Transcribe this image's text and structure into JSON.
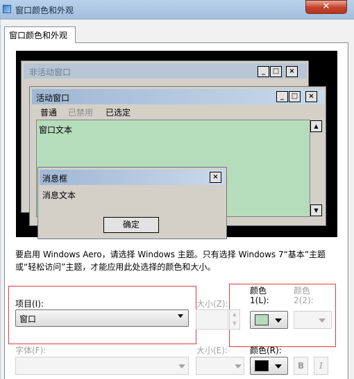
{
  "window": {
    "title": "窗口颜色和外观",
    "close_glyph": "✕"
  },
  "tab": {
    "label": "窗口颜色和外观"
  },
  "preview": {
    "inactive_window_title": "非活动窗口",
    "active_window_title": "活动窗口",
    "menu": {
      "normal": "普通",
      "disabled": "已禁用",
      "selected": "已选定"
    },
    "window_text": "窗口文本",
    "message_box": {
      "title": "消息框",
      "text": "消息文本",
      "ok_label": "确定"
    },
    "caption_buttons": {
      "minimize": "_",
      "maximize": "□",
      "close": "×"
    },
    "scroll_up": "▲",
    "scroll_down": "▼",
    "text_area_color": "#b5dcbb"
  },
  "notice": "要启用 Windows Aero，请选择 Windows 主题。只有选择 Windows 7“基本”主题或“轻松访问”主题，才能应用此处选择的颜色和大小。",
  "form": {
    "item_label": "项目(I):",
    "item_value": "窗口",
    "size_label": "大小(Z):",
    "color1_label_line1": "颜色",
    "color1_label_line2": "1(L):",
    "color1_value": "#b5dcbb",
    "color2_label_line1": "颜色",
    "color2_label_line2": "2(2):",
    "font_label": "字体(F):",
    "font_size_label": "大小(E):",
    "font_color_label": "颜色(R):",
    "font_color_value": "#000000",
    "bold_label": "B",
    "italic_label": "I"
  },
  "colors": {
    "highlight_box": "#e23a3a"
  }
}
